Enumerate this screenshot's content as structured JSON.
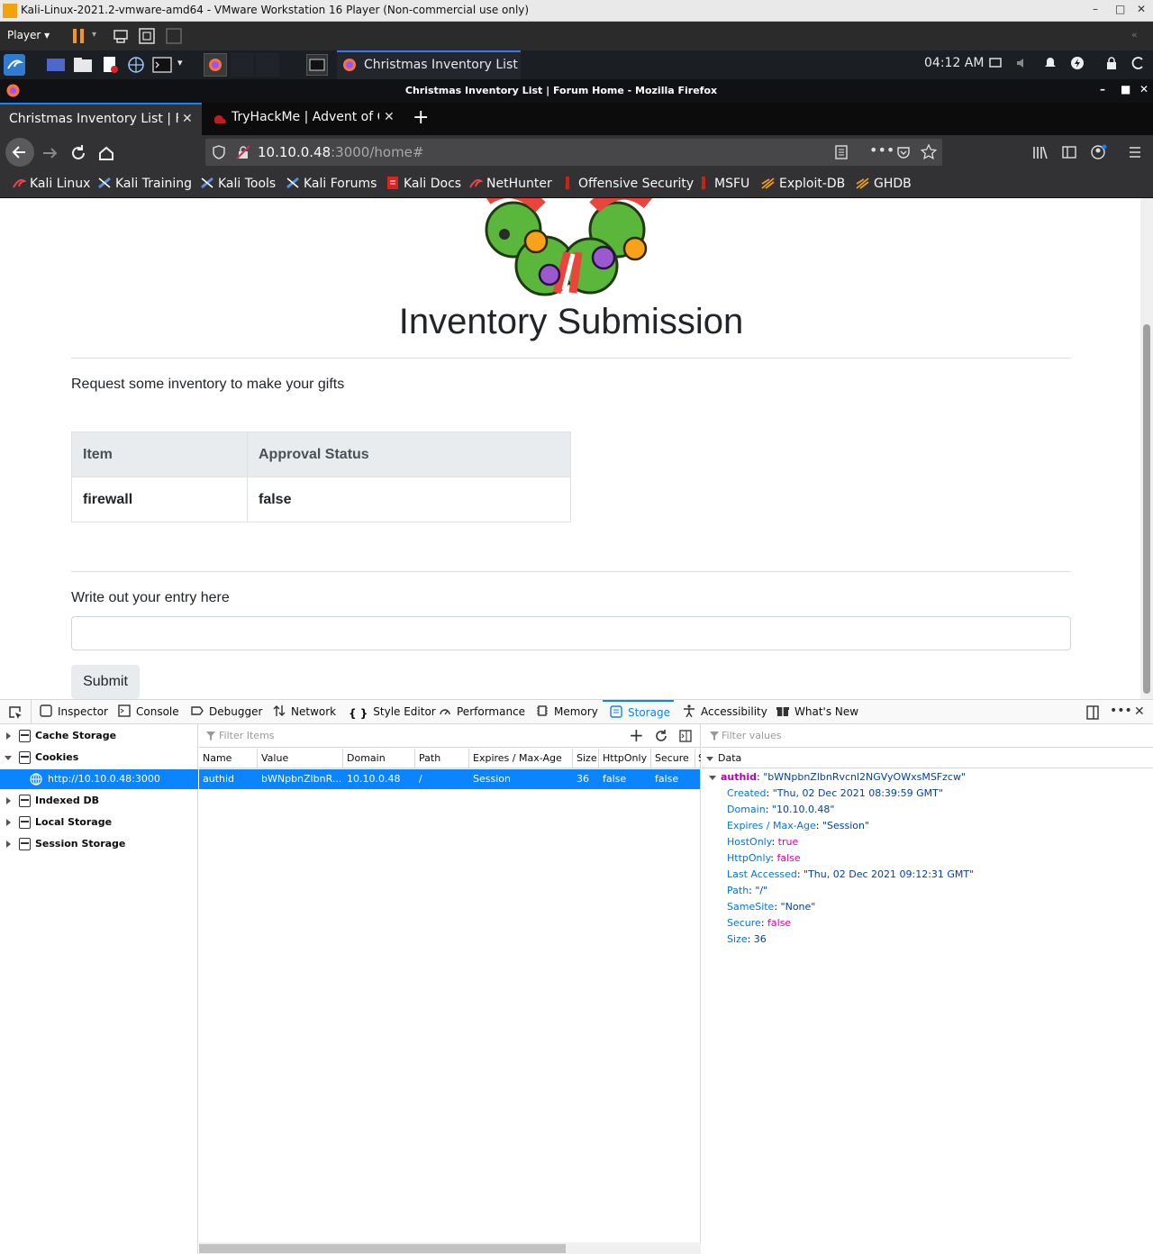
{
  "vmware": {
    "title": "Kali-Linux-2021.2-vmware-amd64 - VMware Workstation 16 Player (Non-commercial use only)",
    "menu_player": "Player"
  },
  "kali_panel": {
    "task_title": "Christmas Inventory List ...",
    "clock": "04:12 AM"
  },
  "firefox": {
    "window_title": "Christmas Inventory List | Forum Home - Mozilla Firefox",
    "tabs": [
      {
        "label": "Christmas Inventory List | Fo",
        "active": true
      },
      {
        "label": "TryHackMe | Advent of C",
        "active": false
      }
    ],
    "url": {
      "host": "10.10.0.48",
      "rest": ":3000/home#"
    },
    "bookmarks": [
      {
        "label": "Kali Linux",
        "icon": "kali-dragon-icon"
      },
      {
        "label": "Kali Training",
        "icon": "kali-training-icon"
      },
      {
        "label": "Kali Tools",
        "icon": "kali-tools-icon"
      },
      {
        "label": "Kali Forums",
        "icon": "kali-forums-icon"
      },
      {
        "label": "Kali Docs",
        "icon": "kali-docs-icon"
      },
      {
        "label": "NetHunter",
        "icon": "nethunter-icon"
      },
      {
        "label": "Offensive Security",
        "icon": "offsec-icon"
      },
      {
        "label": "MSFU",
        "icon": "msfu-icon"
      },
      {
        "label": "Exploit-DB",
        "icon": "exploitdb-icon"
      },
      {
        "label": "GHDB",
        "icon": "ghdb-icon"
      }
    ]
  },
  "page": {
    "title": "Inventory Submission",
    "lead": "Request some inventory to make your gifts",
    "table": {
      "headers": [
        "Item",
        "Approval Status"
      ],
      "rows": [
        [
          "firewall",
          "false"
        ]
      ]
    },
    "entry_label": "Write out your entry here",
    "submit_label": "Submit"
  },
  "devtools": {
    "tabs": [
      "Inspector",
      "Console",
      "Debugger",
      "Network",
      "Style Editor",
      "Performance",
      "Memory",
      "Storage",
      "Accessibility",
      "What's New"
    ],
    "selected_tab": "Storage",
    "sidebar": {
      "cache_storage": "Cache Storage",
      "cookies": "Cookies",
      "cookie_host": "http://10.10.0.48:3000",
      "indexed_db": "Indexed DB",
      "local_storage": "Local Storage",
      "session_storage": "Session Storage"
    },
    "filter_items_placeholder": "Filter Items",
    "filter_values_placeholder": "Filter values",
    "columns": [
      "Name",
      "Value",
      "Domain",
      "Path",
      "Expires / Max-Age",
      "Size",
      "HttpOnly",
      "Secure",
      "S"
    ],
    "row": {
      "name": "authid",
      "value": "bWNpbnZlbnR...",
      "domain": "10.10.0.48",
      "path": "/",
      "expires": "Session",
      "size": "36",
      "httponly": "false",
      "secure": "false"
    },
    "detail": {
      "section": "Data",
      "main_key": "authid",
      "main_value": "\"bWNpbnZlbnRvcnl2NGVyOWxsMSFzcw\"",
      "props": [
        {
          "key": "Created",
          "value": "\"Thu, 02 Dec 2021 08:39:59 GMT\"",
          "kind": "s"
        },
        {
          "key": "Domain",
          "value": "\"10.10.0.48\"",
          "kind": "s"
        },
        {
          "key": "Expires / Max-Age",
          "value": "\"Session\"",
          "kind": "s"
        },
        {
          "key": "HostOnly",
          "value": "true",
          "kind": "b"
        },
        {
          "key": "HttpOnly",
          "value": "false",
          "kind": "b"
        },
        {
          "key": "Last Accessed",
          "value": "\"Thu, 02 Dec 2021 09:12:31 GMT\"",
          "kind": "s"
        },
        {
          "key": "Path",
          "value": "\"/\"",
          "kind": "s"
        },
        {
          "key": "SameSite",
          "value": "\"None\"",
          "kind": "s"
        },
        {
          "key": "Secure",
          "value": "false",
          "kind": "b"
        },
        {
          "key": "Size",
          "value": "36",
          "kind": "n"
        }
      ]
    }
  }
}
